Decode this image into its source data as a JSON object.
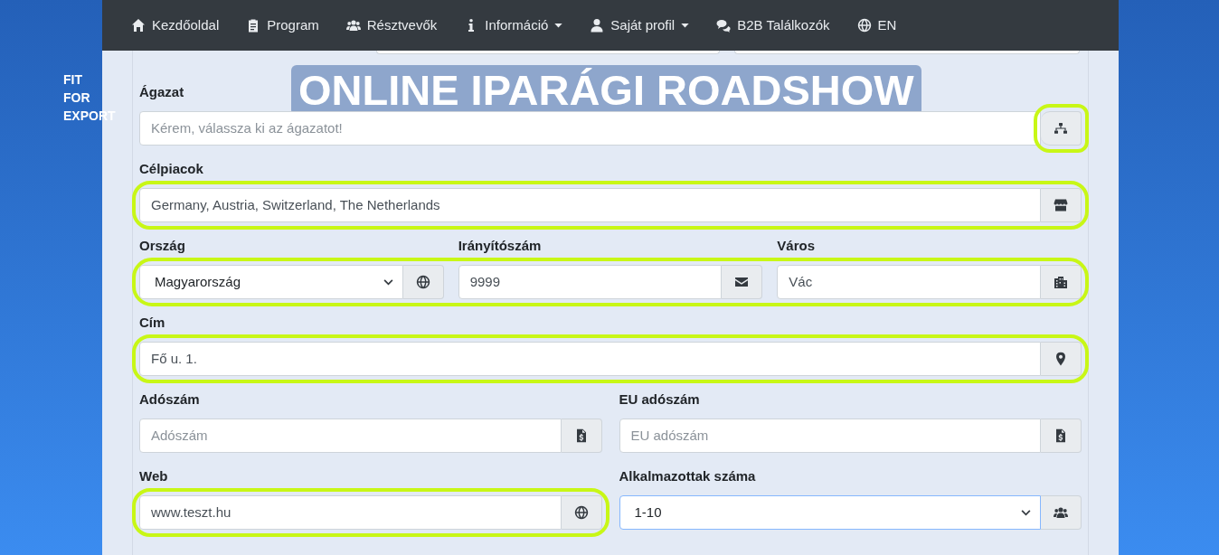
{
  "navbar": {
    "items": [
      {
        "label": "Kezdőoldal",
        "dropdown": false
      },
      {
        "label": "Program",
        "dropdown": false
      },
      {
        "label": "Résztvevők",
        "dropdown": false
      },
      {
        "label": "Információ",
        "dropdown": true
      },
      {
        "label": "Saját profil",
        "dropdown": true
      },
      {
        "label": "B2B Találkozók",
        "dropdown": false
      },
      {
        "label": "EN",
        "dropdown": false
      }
    ]
  },
  "background": {
    "logo": [
      "FIT",
      "FOR",
      "EXPORT"
    ],
    "title": "ONLINE IPARÁGI ROADSHOW"
  },
  "form": {
    "rows": [
      {
        "highlighted": false,
        "fields": [
          {
            "label": "Ágazat",
            "kind": "input",
            "placeholder": "Kérem, válassza ki az ágazatot!",
            "highlighted": false,
            "button_highlighted": true,
            "focused": false
          }
        ]
      },
      {
        "highlighted": false,
        "fields": [
          {
            "label": "Célpiacok",
            "kind": "input",
            "value": "Germany, Austria, Switzerland, The Netherlands",
            "highlighted": true,
            "button_highlighted": false,
            "focused": false
          }
        ]
      },
      {
        "highlighted": true,
        "fields": [
          {
            "label": "Ország",
            "kind": "select",
            "value": "Magyarország",
            "highlighted": false,
            "button_highlighted": false,
            "focused": false
          },
          {
            "label": "Irányítószám",
            "kind": "input",
            "value": "9999",
            "highlighted": false,
            "button_highlighted": false,
            "focused": false
          },
          {
            "label": "Város",
            "kind": "input",
            "value": "Vác",
            "highlighted": false,
            "button_highlighted": false,
            "focused": false
          }
        ]
      },
      {
        "highlighted": false,
        "fields": [
          {
            "label": "Cím",
            "kind": "input",
            "value": "Fő u. 1.",
            "highlighted": true,
            "button_highlighted": false,
            "focused": false
          }
        ]
      },
      {
        "highlighted": false,
        "fields": [
          {
            "label": "Adószám",
            "kind": "input",
            "placeholder": "Adószám",
            "highlighted": false,
            "button_highlighted": false,
            "focused": false
          },
          {
            "label": "EU adószám",
            "kind": "input",
            "placeholder": "EU adószám",
            "highlighted": false,
            "button_highlighted": false,
            "focused": false
          }
        ]
      },
      {
        "highlighted": false,
        "fields": [
          {
            "label": "Web",
            "kind": "input",
            "value": "www.teszt.hu",
            "highlighted": true,
            "button_highlighted": false,
            "focused": false
          },
          {
            "label": "Alkalmazottak száma",
            "kind": "select",
            "value": "1-10",
            "highlighted": false,
            "button_highlighted": false,
            "focused": true
          }
        ]
      }
    ]
  }
}
